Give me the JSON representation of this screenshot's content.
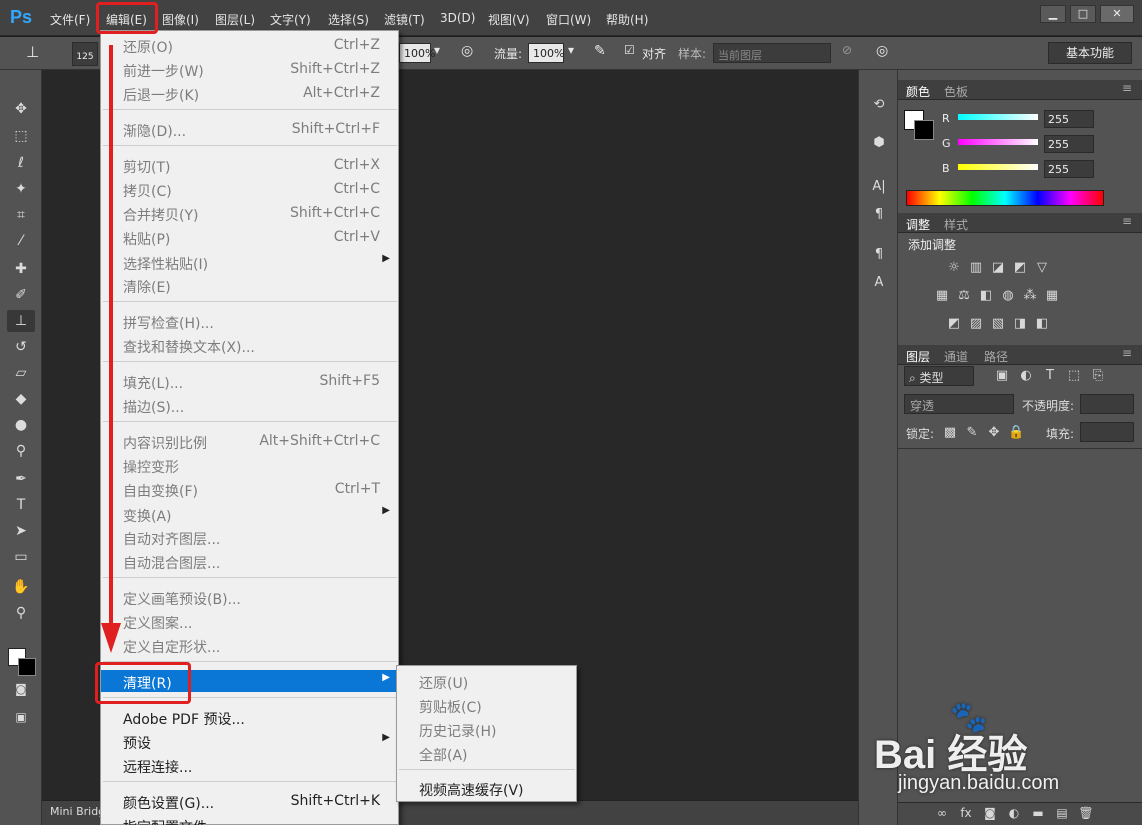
{
  "app": {
    "logo": "Ps"
  },
  "menubar": {
    "items": [
      "文件(F)",
      "编辑(E)",
      "图像(I)",
      "图层(L)",
      "文字(Y)",
      "选择(S)",
      "滤镜(T)",
      "3D(D)",
      "视图(V)",
      "窗口(W)",
      "帮助(H)"
    ],
    "active_index": 1
  },
  "options_bar": {
    "brush_size": "125",
    "opacity_value": "100%",
    "flow_label": "流量:",
    "flow_value": "100%",
    "align_label": "对齐",
    "sample_label": "样本:",
    "sample_value": "当前图层",
    "workspace": "基本功能"
  },
  "edit_menu": {
    "groups": [
      [
        {
          "label": "还原(O)",
          "shortcut": "Ctrl+Z",
          "disabled": true
        },
        {
          "label": "前进一步(W)",
          "shortcut": "Shift+Ctrl+Z",
          "disabled": true
        },
        {
          "label": "后退一步(K)",
          "shortcut": "Alt+Ctrl+Z",
          "disabled": true
        }
      ],
      [
        {
          "label": "渐隐(D)...",
          "shortcut": "Shift+Ctrl+F",
          "disabled": true
        }
      ],
      [
        {
          "label": "剪切(T)",
          "shortcut": "Ctrl+X",
          "disabled": true
        },
        {
          "label": "拷贝(C)",
          "shortcut": "Ctrl+C",
          "disabled": true
        },
        {
          "label": "合并拷贝(Y)",
          "shortcut": "Shift+Ctrl+C",
          "disabled": true
        },
        {
          "label": "粘贴(P)",
          "shortcut": "Ctrl+V",
          "disabled": true
        },
        {
          "label": "选择性粘贴(I)",
          "shortcut": "",
          "submenu": true,
          "disabled": true
        },
        {
          "label": "清除(E)",
          "shortcut": "",
          "disabled": true
        }
      ],
      [
        {
          "label": "拼写检查(H)...",
          "shortcut": "",
          "disabled": true
        },
        {
          "label": "查找和替换文本(X)...",
          "shortcut": "",
          "disabled": true
        }
      ],
      [
        {
          "label": "填充(L)...",
          "shortcut": "Shift+F5",
          "disabled": true
        },
        {
          "label": "描边(S)...",
          "shortcut": "",
          "disabled": true
        }
      ],
      [
        {
          "label": "内容识别比例",
          "shortcut": "Alt+Shift+Ctrl+C",
          "disabled": true
        },
        {
          "label": "操控变形",
          "shortcut": "",
          "disabled": true
        },
        {
          "label": "自由变换(F)",
          "shortcut": "Ctrl+T",
          "disabled": true
        },
        {
          "label": "变换(A)",
          "shortcut": "",
          "submenu": true,
          "disabled": true
        },
        {
          "label": "自动对齐图层...",
          "shortcut": "",
          "disabled": true
        },
        {
          "label": "自动混合图层...",
          "shortcut": "",
          "disabled": true
        }
      ],
      [
        {
          "label": "定义画笔预设(B)...",
          "shortcut": "",
          "disabled": true
        },
        {
          "label": "定义图案...",
          "shortcut": "",
          "disabled": true
        },
        {
          "label": "定义自定形状...",
          "shortcut": "",
          "disabled": true
        }
      ],
      [
        {
          "label": "清理(R)",
          "shortcut": "",
          "submenu": true,
          "highlight": true
        }
      ],
      [
        {
          "label": "Adobe PDF 预设...",
          "shortcut": ""
        },
        {
          "label": "预设",
          "shortcut": "",
          "submenu": true
        },
        {
          "label": "远程连接...",
          "shortcut": ""
        }
      ],
      [
        {
          "label": "颜色设置(G)...",
          "shortcut": "Shift+Ctrl+K"
        },
        {
          "label": "指定配置文件...",
          "shortcut": ""
        }
      ]
    ]
  },
  "purge_submenu": {
    "items": [
      {
        "label": "还原(U)",
        "disabled": true
      },
      {
        "label": "剪贴板(C)",
        "disabled": true
      },
      {
        "label": "历史记录(H)",
        "disabled": true
      },
      {
        "label": "全部(A)",
        "disabled": true
      },
      {
        "label": "视频高速缓存(V)",
        "disabled": false
      }
    ]
  },
  "color_panel": {
    "tabs": [
      "颜色",
      "色板"
    ],
    "channels": [
      {
        "name": "R",
        "value": "255",
        "gradient": "#00ffff"
      },
      {
        "name": "G",
        "value": "255",
        "gradient": "#ff00ff"
      },
      {
        "name": "B",
        "value": "255",
        "gradient": "#ffff00"
      }
    ]
  },
  "adjust_panel": {
    "tabs": [
      "调整",
      "样式"
    ],
    "title": "添加调整"
  },
  "layers_panel": {
    "tabs": [
      "图层",
      "通道",
      "路径"
    ],
    "filter_label": "类型",
    "blend_mode": "穿透",
    "opacity_label": "不透明度:",
    "lock_label": "锁定:",
    "fill_label": "填充:"
  },
  "bottom": {
    "mini_bridge": "Mini Bridge"
  },
  "watermark": {
    "main": "Bai  经验",
    "sub": "jingyan.baidu.com"
  },
  "colors": {
    "highlight": "#0a76d6",
    "annotation": "#e02020",
    "ps_blue": "#31a8ff"
  }
}
